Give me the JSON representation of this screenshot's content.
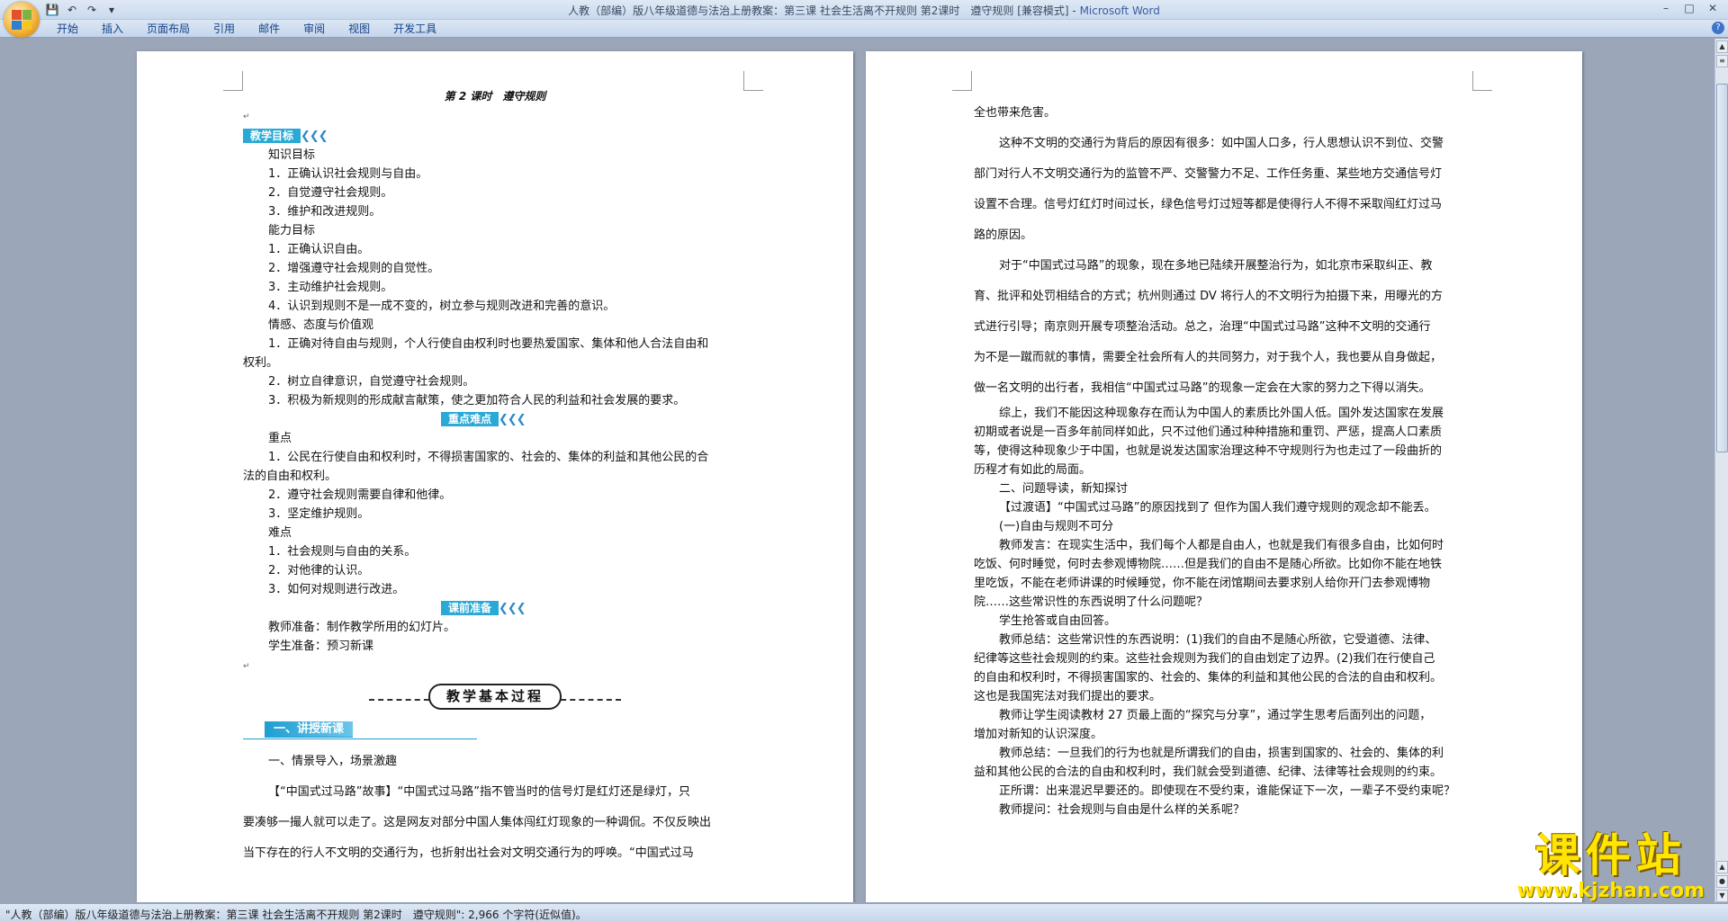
{
  "window": {
    "title": "人教（部编）版八年级道德与法治上册教案：第三课 社会生活离不开规则 第2课时　遵守规则 [兼容模式]",
    "app_name": "Microsoft Word",
    "controls": {
      "minimize": "–",
      "maximize": "□",
      "close": "✕"
    }
  },
  "quick_access": {
    "save": "💾",
    "undo": "↶",
    "redo": "↷",
    "more": "▾"
  },
  "ribbon": {
    "tabs": [
      "开始",
      "插入",
      "页面布局",
      "引用",
      "邮件",
      "审阅",
      "视图",
      "开发工具"
    ],
    "help": "?"
  },
  "page1": {
    "title": "第 2 课时　遵守规则",
    "sections": {
      "objectives": "教学目标",
      "keypoints": "重点难点",
      "prep": "课前准备"
    },
    "arrows": "❮❮❮",
    "lines_a": [
      "知识目标",
      "1．正确认识社会规则与自由。",
      "2．自觉遵守社会规则。",
      "3．维护和改进规则。",
      "能力目标",
      "1．正确认识自由。",
      "2．增强遵守社会规则的自觉性。",
      "3．主动维护社会规则。",
      "4．认识到规则不是一成不变的，树立参与规则改进和完善的意识。",
      "情感、态度与价值观",
      "1．正确对待自由与规则，个人行使自由权利时也要热爱国家、集体和他人合法自由和",
      "权利。",
      "2．树立自律意识，自觉遵守社会规则。",
      "3．积极为新规则的形成献言献策，使之更加符合人民的利益和社会发展的要求。"
    ],
    "lines_b": [
      "重点",
      "1．公民在行使自由和权利时，不得损害国家的、社会的、集体的利益和其他公民的合",
      "法的自由和权利。",
      "2．遵守社会规则需要自律和他律。",
      "3．坚定维护规则。",
      "难点",
      "1．社会规则与自由的关系。",
      "2．对他律的认识。",
      "3．如何对规则进行改进。"
    ],
    "lines_c": [
      "教师准备：制作教学所用的幻灯片。",
      "学生准备：预习新课"
    ],
    "banner": "教学基本过程",
    "lesson_head": "一、讲授新课",
    "lines_d": [
      "一、情景导入，场景激趣",
      "【“中国式过马路”故事】“中国式过马路”指不管当时的信号灯是红灯还是绿灯，只",
      "要凑够一撮人就可以走了。这是网友对部分中国人集体闯红灯现象的一种调侃。不仅反映出",
      "当下存在的行人不文明的交通行为，也折射出社会对文明交通行为的呼唤。“中国式过马"
    ]
  },
  "page2": {
    "lines_a": [
      "全也带来危害。",
      "这种不文明的交通行为背后的原因有很多：如中国人口多，行人思想认识不到位、交警",
      "部门对行人不文明交通行为的监管不严、交警警力不足、工作任务重、某些地方交通信号灯",
      "设置不合理。信号灯红灯时间过长，绿色信号灯过短等都是使得行人不得不采取闯红灯过马",
      "路的原因。",
      "对于“中国式过马路”的现象，现在多地已陆续开展整治行为，如北京市采取纠正、教",
      "育、批评和处罚相结合的方式；杭州则通过 DV 将行人的不文明行为拍摄下来，用曝光的方",
      "式进行引导；南京则开展专项整治活动。总之，治理“中国式过马路”这种不文明的交通行",
      "为不是一蹴而就的事情，需要全社会所有人的共同努力，对于我个人，我也要从自身做起，",
      "做一名文明的出行者，我相信“中国式过马路”的现象一定会在大家的努力之下得以消失。"
    ],
    "lines_b": [
      "综上，我们不能因这种现象存在而认为中国人的素质比外国人低。国外发达国家在发展",
      "初期或者说是一百多年前同样如此，只不过他们通过种种措施和重罚、严惩，提高人口素质",
      "等，使得这种现象少于中国，也就是说发达国家治理这种不守规则行为也走过了一段曲折的",
      "历程才有如此的局面。",
      "二、问题导读，新知探讨",
      "【过渡语】“中国式过马路”的原因找到了 但作为国人我们遵守规则的观念却不能丢。",
      "(一)自由与规则不可分",
      "教师发言：在现实生活中，我们每个人都是自由人，也就是我们有很多自由，比如何时",
      "吃饭、何时睡觉，何时去参观博物院……但是我们的自由不是随心所欲。比如你不能在地铁",
      "里吃饭，不能在老师讲课的时候睡觉，你不能在闭馆期间去要求别人给你开门去参观博物",
      "院……这些常识性的东西说明了什么问题呢？",
      "学生抢答或自由回答。",
      "教师总结：这些常识性的东西说明：(1)我们的自由不是随心所欲，它受道德、法律、",
      "纪律等这些社会规则的约束。这些社会规则为我们的自由划定了边界。(2)我们在行使自己",
      "的自由和权利时，不得损害国家的、社会的、集体的利益和其他公民的合法的自由和权利。",
      "这也是我国宪法对我们提出的要求。",
      "教师让学生阅读教材 27 页最上面的“探究与分享”，通过学生思考后面列出的问题，",
      "增加对新知的认识深度。",
      "教师总结：一旦我们的行为也就是所谓我们的自由，损害到国家的、社会的、集体的利",
      "益和其他公民的合法的自由和权利时，我们就会受到道德、纪律、法律等社会规则的约束。",
      "正所谓：出来混迟早要还的。即使现在不受约束，谁能保证下一次，一辈子不受约束呢？",
      "教师提问：社会规则与自由是什么样的关系呢？"
    ]
  },
  "status": {
    "text": "\"人教（部编）版八年级道德与法治上册教案：第三课 社会生活离不开规则 第2课时　遵守规则\": 2,966 个字符(近似值)。"
  },
  "watermark": {
    "main": "课件站",
    "url": "www.kjzhan.com"
  }
}
